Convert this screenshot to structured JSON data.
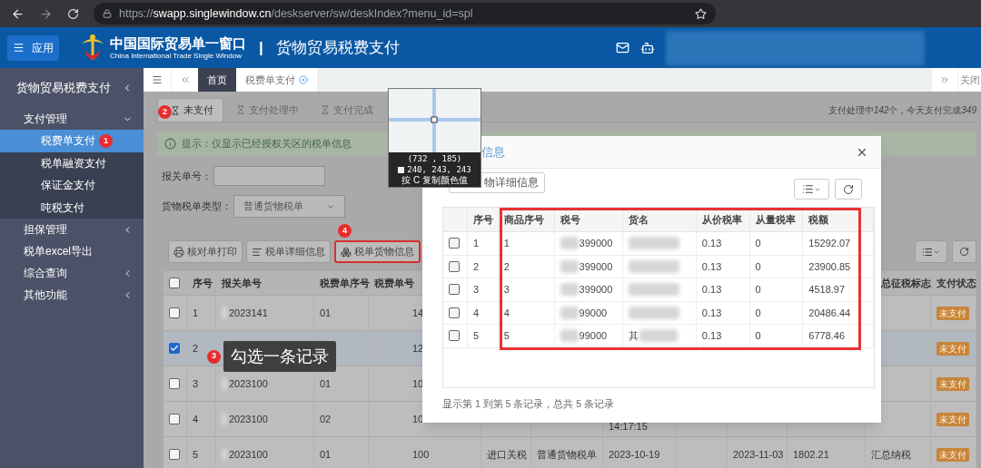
{
  "browser": {
    "url_scheme": "https://",
    "url_host": "swapp.singlewindow.cn",
    "url_path": "/deskserver/sw/deskIndex?menu_id=spl"
  },
  "header": {
    "apps_button": "应用",
    "brand_title": "中国国际贸易单一窗口",
    "brand_subtitle": "China International Trade Single Window",
    "separator": "|",
    "page_title": "货物贸易税费支付"
  },
  "sidebar": {
    "title": "货物贸易税费支付",
    "items": [
      {
        "label": "支付管理",
        "kind": "group",
        "expanded": true,
        "children": [
          {
            "label": "税费单支付",
            "selected": true,
            "badge": "1"
          },
          {
            "label": "税单融资支付",
            "selected": false
          },
          {
            "label": "保证金支付",
            "selected": false
          },
          {
            "label": "吨税支付",
            "selected": false
          }
        ]
      },
      {
        "label": "担保管理",
        "kind": "group",
        "expanded": false
      },
      {
        "label": "税单excel导出",
        "kind": "link"
      },
      {
        "label": "综合查询",
        "kind": "group",
        "expanded": false
      },
      {
        "label": "其他功能",
        "kind": "group",
        "expanded": false
      }
    ]
  },
  "page_tabs": {
    "tabs": [
      {
        "label": "首页",
        "selected": true,
        "closable": false
      },
      {
        "label": "税费单支付",
        "selected": false,
        "closable": true
      }
    ],
    "close_tabs": "关闭"
  },
  "status_tabs": [
    {
      "label": "未支付",
      "selected": true,
      "badge": "2"
    },
    {
      "label": "支付处理中",
      "selected": false
    },
    {
      "label": "支付完成",
      "selected": false
    }
  ],
  "summary": {
    "processing_label": "支付处理中",
    "processing_count": "142",
    "completed_label": "个，今天支付完成",
    "completed_count": "349"
  },
  "hint": "提示：仅显示已经授权关区的税单信息",
  "form": {
    "declaration_label": "报关单号：",
    "type_label": "货物税单类型：",
    "type_value": "普通货物税单"
  },
  "actions": [
    {
      "label": "核对单打印",
      "kind": "print",
      "highlighted": false
    },
    {
      "label": "税单详细信息",
      "kind": "list",
      "highlighted": false
    },
    {
      "label": "税单货物信息",
      "kind": "goods",
      "highlighted": true,
      "badge": "4"
    }
  ],
  "table": {
    "select_all": false,
    "columns": [
      "序号",
      "报关单号",
      "税费单序号",
      "税费单号",
      "总征税标志",
      "支付状态"
    ],
    "rows": [
      {
        "no": "1",
        "declaration_no": "2023141",
        "tax_seq": "01",
        "tax_no": "14",
        "status": "未支付",
        "checked": false
      },
      {
        "no": "2",
        "tax_no": "12",
        "status": "未支付",
        "checked": true
      },
      {
        "no": "3",
        "declaration_no": "2023100",
        "tax_seq": "01",
        "tax_no": "10",
        "status": "未支付",
        "checked": false
      },
      {
        "no": "4",
        "declaration_no": "2023100",
        "tax_seq": "02",
        "tax_no": "10",
        "column_8": "14:17:15",
        "status": "未支付",
        "checked": false
      },
      {
        "no": "5",
        "declaration_no": "2023100",
        "tax_seq": "01",
        "tax_no": "100",
        "column_6": "进口关税",
        "column_7": "普通货物税单",
        "column_8": "2023-10-19",
        "column_10": "2023-11-03",
        "column_11": "1802.21",
        "column_12": "汇总纳税",
        "status": "未支付",
        "checked": false
      }
    ]
  },
  "tooltip": {
    "badge": "3",
    "text": "勾选一条记录"
  },
  "color_picker": {
    "coords": "(732 , 185)",
    "rgb": "240, 243, 243",
    "hint": "按 C 复制颜色值"
  },
  "modal": {
    "title": "信息",
    "detail_button": "物详细信息",
    "highlight": true,
    "columns": [
      "序号",
      "商品序号",
      "税号",
      "货名",
      "从价税率",
      "从量税率",
      "税额"
    ],
    "rows": [
      {
        "no": "1",
        "item_no": "1",
        "hs_code": "399000",
        "tax_rate": "0.13",
        "specific_rate": "0",
        "amount": "15292.07",
        "checked": false
      },
      {
        "no": "2",
        "item_no": "2",
        "hs_code": "399000",
        "tax_rate": "0.13",
        "specific_rate": "0",
        "amount": "23900.85",
        "checked": false
      },
      {
        "no": "3",
        "item_no": "3",
        "hs_code": "399000",
        "tax_rate": "0.13",
        "specific_rate": "0",
        "amount": "4518.97",
        "checked": false
      },
      {
        "no": "4",
        "item_no": "4",
        "hs_code": "99000",
        "tax_rate": "0.13",
        "specific_rate": "0",
        "amount": "20486.44",
        "checked": false
      },
      {
        "no": "5",
        "item_no": "5",
        "hs_code": "99000",
        "name": "其",
        "tax_rate": "0.13",
        "specific_rate": "0",
        "amount": "6778.46",
        "checked": false
      }
    ],
    "footer": "显示第 1 到第 5 条记录，总共 5 条记录"
  }
}
